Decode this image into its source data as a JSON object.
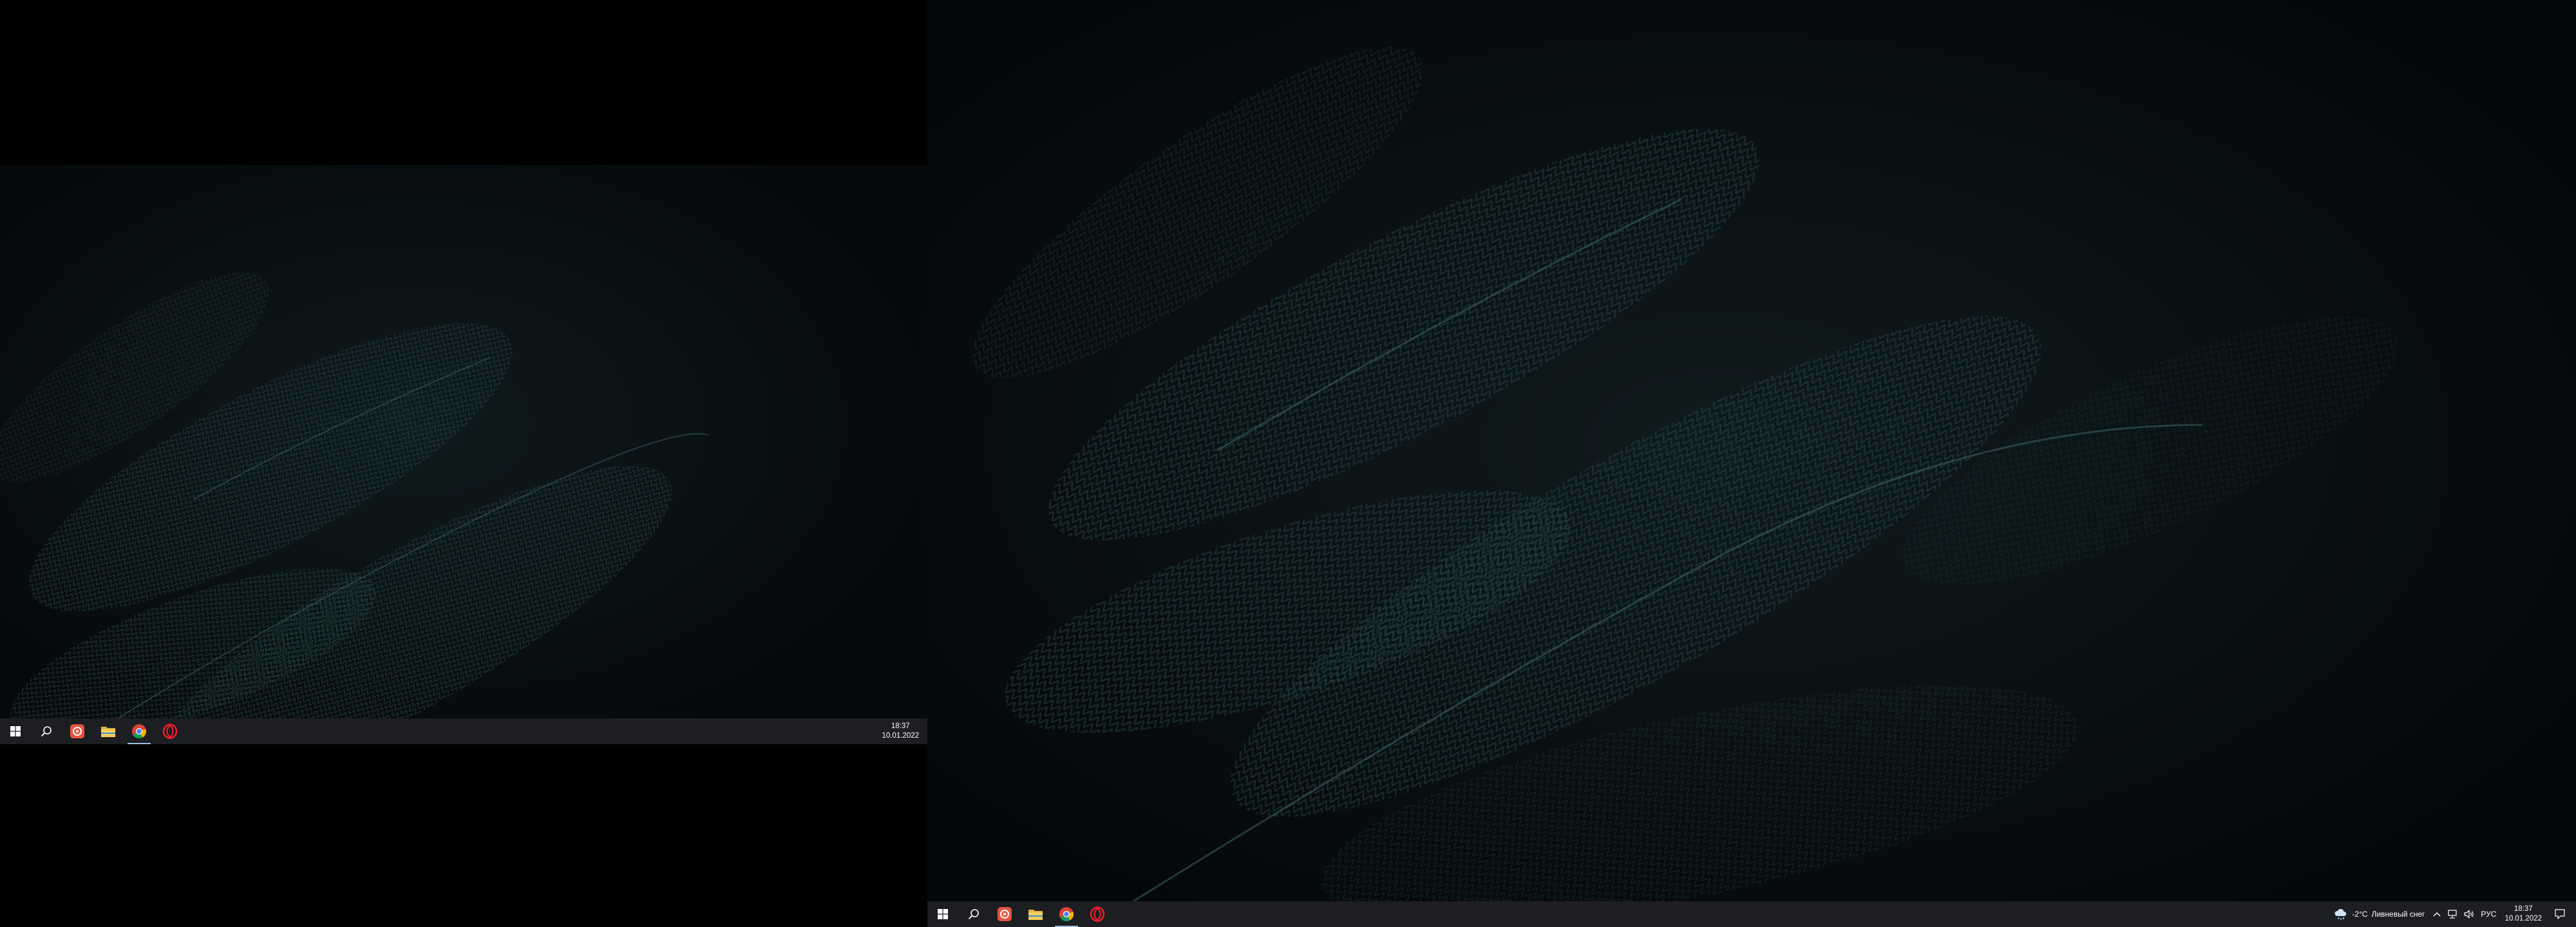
{
  "screens": {
    "left": {
      "taskbar": {
        "apps": [
          {
            "name": "start-button",
            "icon": "windows-logo-icon"
          },
          {
            "name": "search-button",
            "icon": "search-icon"
          },
          {
            "name": "app-red-icon-button",
            "icon": "red-square-app-icon"
          },
          {
            "name": "file-explorer-button",
            "icon": "folder-icon"
          },
          {
            "name": "chrome-button",
            "icon": "chrome-icon",
            "active": true
          },
          {
            "name": "opera-button",
            "icon": "opera-icon"
          }
        ],
        "clock": {
          "time": "18:37",
          "date": "10.01.2022"
        }
      }
    },
    "right": {
      "taskbar": {
        "apps": [
          {
            "name": "start-button",
            "icon": "windows-logo-icon"
          },
          {
            "name": "search-button",
            "icon": "search-icon"
          },
          {
            "name": "app-red-icon-button",
            "icon": "red-square-app-icon"
          },
          {
            "name": "file-explorer-button",
            "icon": "folder-icon"
          },
          {
            "name": "chrome-button",
            "icon": "chrome-icon",
            "active": true
          },
          {
            "name": "opera-button",
            "icon": "opera-icon"
          }
        ],
        "weather": {
          "temperature": "-2°C",
          "condition": "Ливневый снег",
          "icon": "cloud-snow-icon"
        },
        "tray": {
          "language": "РУС",
          "icons": [
            "chevron-up-icon",
            "network-icon",
            "volume-icon"
          ]
        },
        "clock": {
          "time": "18:37",
          "date": "10.01.2022"
        },
        "notification_icon": "action-center-icon"
      }
    }
  },
  "colors": {
    "taskbar": "#1c1e21",
    "wallpaper_dark": "#05090b",
    "fern": "#2c5150",
    "active_indicator": "#9bbde6"
  }
}
